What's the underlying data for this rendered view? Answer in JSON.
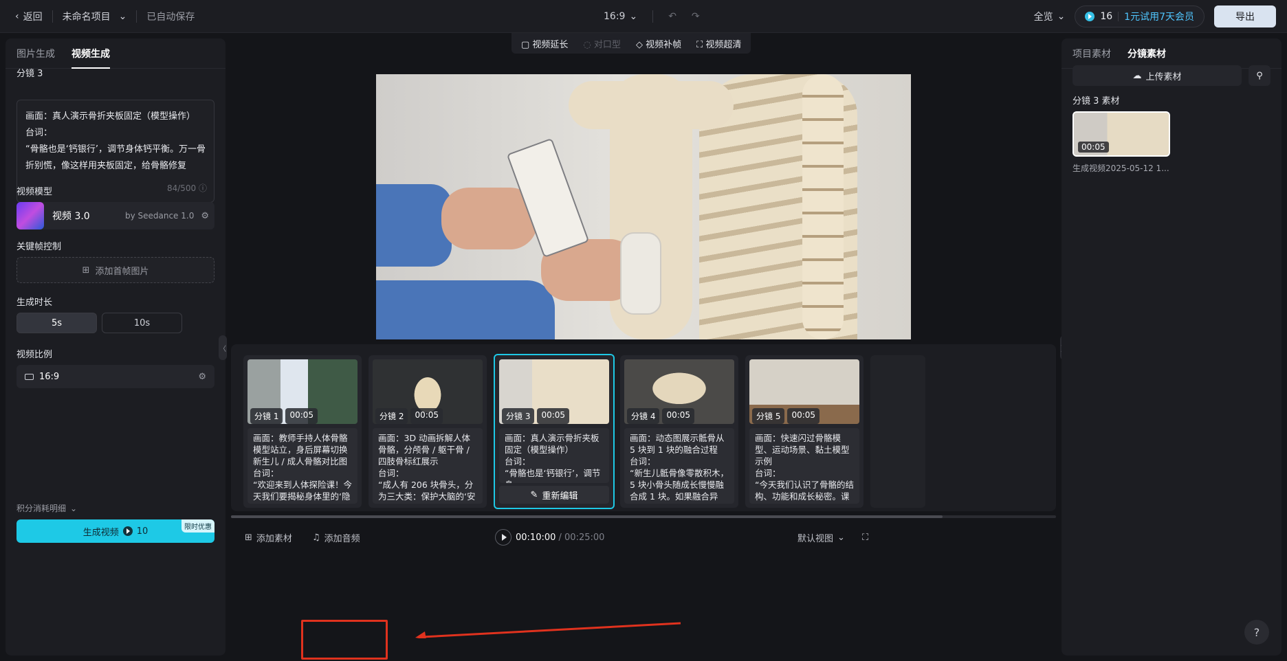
{
  "topbar": {
    "back": "返回",
    "project": "未命名项目",
    "autosave": "已自动保存",
    "ratio": "16:9",
    "view": "全览",
    "credits": "16",
    "vip": "1元试用7天会员",
    "export": "导出"
  },
  "left": {
    "tabs": [
      "图片生成",
      "视频生成"
    ],
    "shot_title": "分镜 3",
    "prompt_lines": [
      "画面：真人演示骨折夹板固定（模型操作）",
      "台词：",
      "“骨骼也是‘钙银行’，调节身体钙平衡。万一骨折别慌，像这样用夹板固定，给骨骼修复"
    ],
    "counter": "84/500",
    "model_label": "视频模型",
    "model_name": "视频 3.0",
    "model_by": "by Seedance 1.0",
    "keyframe_label": "关键帧控制",
    "add_first_frame": "添加首帧图片",
    "duration_label": "生成时长",
    "dur_5": "5s",
    "dur_10": "10s",
    "ratio_label": "视频比例",
    "ratio_value": "16:9",
    "consume": "积分消耗明细",
    "generate": "生成视频",
    "generate_cost": "10",
    "promo": "限时优惠"
  },
  "toolstrip": {
    "extend": "视频延长",
    "lipsync": "对口型",
    "interp": "视频补帧",
    "superres": "视频超清"
  },
  "cards": [
    {
      "label": "分镜 1",
      "dur": "00:05",
      "text": "画面：教师手持人体骨骼模型站立，身后屏幕切换新生儿 / 成人骨骼对比图\n台词：\n“欢迎来到人体探险课！今天我们要揭秘身体里的‘隐形城"
    },
    {
      "label": "分镜 2",
      "dur": "00:05",
      "text": "画面：3D 动画拆解人体骨骼，分颅骨 / 躯干骨 / 四肢骨标红展示\n台词：\n“成人有 206 块骨头，分为三大类：保护大脑的‘安全帽’颅"
    },
    {
      "label": "分镜 3",
      "dur": "00:05",
      "text": "画面：真人演示骨折夹板固定（模型操作）\n台词：\n“骨骼也是‘钙银行’，调节身",
      "reedit": "重新编辑"
    },
    {
      "label": "分镜 4",
      "dur": "00:05",
      "text": "画面：动态图展示骶骨从 5 块到 1 块的融合过程\n台词：\n“新生儿骶骨像零散积木，5 块小骨头随成长慢慢融合成 1 块。如果融合异常，可能引发腰"
    },
    {
      "label": "分镜 5",
      "dur": "00:05",
      "text": "画面：快速闪过骨骼模型、运动场景、黏土模型示例\n台词：\n“今天我们认识了骨骼的结构、功能和成长秘密。课后有两个小任务："
    }
  ],
  "bottom": {
    "add_material": "添加素材",
    "add_audio": "添加音频",
    "time_current": "00:10:00",
    "time_total": " / 00:25:00",
    "default_view": "默认视图"
  },
  "right": {
    "tabs": [
      "项目素材",
      "分镜素材"
    ],
    "upload": "上传素材",
    "section": "分镜 3 素材",
    "asset_dur": "00:05",
    "asset_name": "生成视频2025-05-12 1..."
  },
  "help": "?"
}
